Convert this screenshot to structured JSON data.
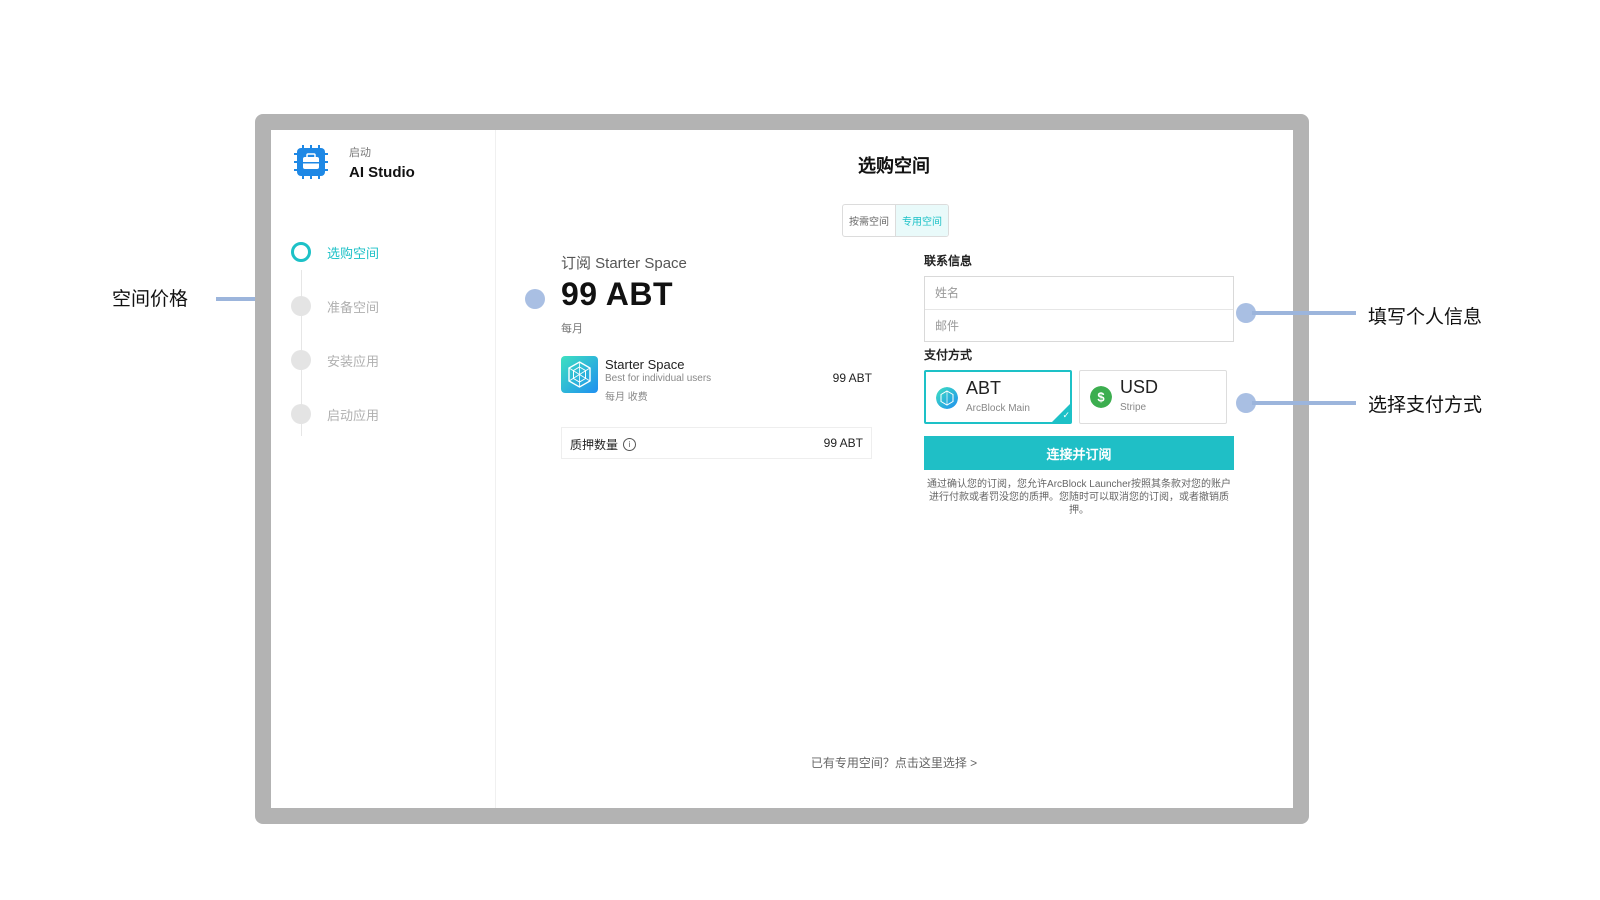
{
  "app": {
    "subtitle": "启动",
    "name": "AI Studio"
  },
  "steps": [
    {
      "label": "选购空间",
      "active": true
    },
    {
      "label": "准备空间",
      "active": false
    },
    {
      "label": "安装应用",
      "active": false
    },
    {
      "label": "启动应用",
      "active": false
    }
  ],
  "page": {
    "title": "选购空间"
  },
  "space_toggle": {
    "options": [
      "按需空间",
      "专用空间"
    ],
    "selected": "专用空间"
  },
  "subscription": {
    "title": "订阅 Starter Space",
    "price": "99 ABT",
    "period": "每月",
    "plan": {
      "name": "Starter Space",
      "description": "Best for individual users",
      "billing": "每月 收费",
      "price": "99 ABT"
    },
    "stake": {
      "label": "质押数量",
      "value": "99 ABT"
    }
  },
  "contact": {
    "label": "联系信息",
    "name_placeholder": "姓名",
    "email_placeholder": "邮件",
    "name_value": "",
    "email_value": ""
  },
  "payment": {
    "label": "支付方式",
    "methods": [
      {
        "name": "ABT",
        "sub": "ArcBlock Main",
        "selected": true,
        "icon": "abt-token-icon"
      },
      {
        "name": "USD",
        "sub": "Stripe",
        "selected": false,
        "icon": "dollar-icon"
      }
    ]
  },
  "cta": {
    "label": "连接并订阅"
  },
  "terms": "通过确认您的订阅，您允许ArcBlock Launcher按照其条款对您的账户进行付款或者罚没您的质押。您随时可以取消您的订阅，或者撤销质押。",
  "footer": {
    "link": "已有专用空间？点击这里选择 >"
  },
  "annotations": {
    "price": "空间价格",
    "contact": "填写个人信息",
    "payment": "选择支付方式"
  },
  "colors": {
    "accent": "#1dc1c7",
    "annotation": "#9cb5dc",
    "frame": "#b3b3b3"
  }
}
